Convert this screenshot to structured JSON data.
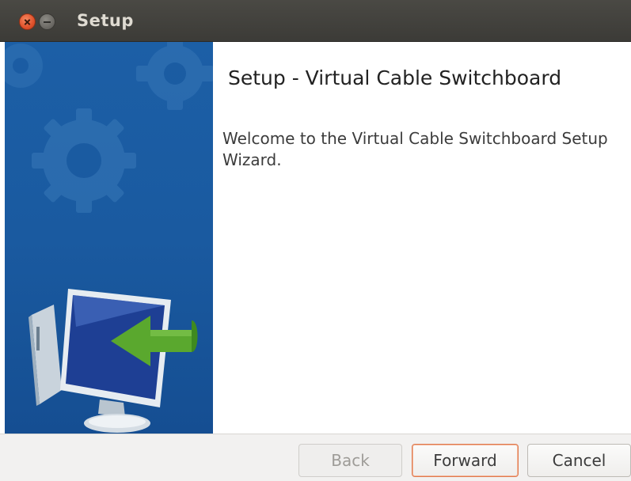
{
  "window": {
    "title": "Setup",
    "controls": [
      "close-icon",
      "minimize-icon"
    ]
  },
  "side_panel": {
    "decorations": [
      "gear-icon",
      "computer-monitor-icon",
      "arrow-left-icon"
    ],
    "background_color": "#1b5ca3"
  },
  "content": {
    "heading": "Setup - Virtual Cable Switchboard",
    "welcome_text": "Welcome to the Virtual Cable Switchboard Setup Wizard."
  },
  "footer": {
    "back_label": "Back",
    "forward_label": "Forward",
    "cancel_label": "Cancel"
  },
  "colors": {
    "titlebar": "#3c3b37",
    "close_button": "#e0512b",
    "forward_border": "#e07a4f"
  }
}
